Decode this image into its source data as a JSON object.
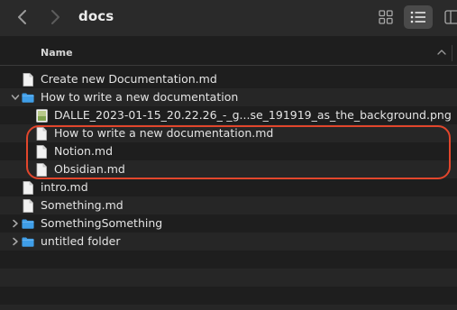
{
  "window": {
    "title": "docs"
  },
  "toolbar": {
    "back_icon": "chevron-left-icon",
    "forward_icon": "chevron-right-icon",
    "view_icons_icon": "grid-icon",
    "view_list_icon": "list-icon",
    "view_columns_icon": "columns-icon"
  },
  "header": {
    "name_label": "Name"
  },
  "files": [
    {
      "label": "Create new Documentation.md",
      "kind": "document",
      "level": 0
    },
    {
      "label": "How to write a new documentation",
      "kind": "folder",
      "level": 0,
      "expanded": true
    },
    {
      "label": "DALLE_2023-01-15_20.22.26_-_g...se_191919_as_the_background.png",
      "kind": "image",
      "level": 1
    },
    {
      "label": "How to write a new documentation.md",
      "kind": "document",
      "level": 1
    },
    {
      "label": "Notion.md",
      "kind": "document",
      "level": 1
    },
    {
      "label": "Obsidian.md",
      "kind": "document",
      "level": 1
    },
    {
      "label": "intro.md",
      "kind": "document",
      "level": 0
    },
    {
      "label": "Something.md",
      "kind": "document",
      "level": 0
    },
    {
      "label": "SomethingSomething",
      "kind": "folder",
      "level": 0,
      "expanded": false
    },
    {
      "label": "untitled folder",
      "kind": "folder",
      "level": 0,
      "expanded": false
    }
  ],
  "colors": {
    "folder": "#3f9ee8",
    "highlight": "#e2462c",
    "window_bg": "#1e1e1e"
  }
}
